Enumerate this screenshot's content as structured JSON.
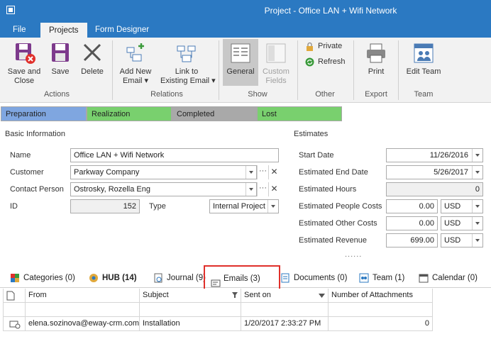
{
  "window": {
    "title": "Project - Office LAN + Wifi Network"
  },
  "menu_tabs": [
    "File",
    "Projects",
    "Form Designer"
  ],
  "ribbon": {
    "save_and_close": "Save and\nClose",
    "save": "Save",
    "delete": "Delete",
    "add_new_email": "Add New\nEmail ▾",
    "link_existing_email": "Link to\nExisting Email ▾",
    "general": "General",
    "custom_fields": "Custom\nFields",
    "private": "Private",
    "refresh": "Refresh",
    "print": "Print",
    "edit_team": "Edit Team",
    "groups": {
      "actions": "Actions",
      "relations": "Relations",
      "show": "Show",
      "other": "Other",
      "export": "Export",
      "team": "Team"
    }
  },
  "stages": [
    {
      "label": "Preparation",
      "color": "#7fa6e0"
    },
    {
      "label": "Realization",
      "color": "#79d06e"
    },
    {
      "label": "Completed",
      "color": "#a9a9a9"
    },
    {
      "label": "Lost",
      "color": "#79d06e"
    }
  ],
  "basic": {
    "heading": "Basic Information",
    "name_label": "Name",
    "name_value": "Office LAN + Wifi Network",
    "customer_label": "Customer",
    "customer_value": "Parkway Company",
    "contact_label": "Contact Person",
    "contact_value": "Ostrosky, Rozella Eng",
    "id_label": "ID",
    "id_value": "152",
    "type_label": "Type",
    "type_value": "Internal Project",
    "dots": "···",
    "clear": "✕"
  },
  "estimates": {
    "heading": "Estimates",
    "start_label": "Start Date",
    "start_value": "11/26/2016",
    "end_label": "Estimated End Date",
    "end_value": "5/26/2017",
    "hours_label": "Estimated Hours",
    "hours_value": "0",
    "people_label": "Estimated People Costs",
    "people_value": "0.00",
    "people_currency": "USD",
    "other_label": "Estimated Other Costs",
    "other_value": "0.00",
    "other_currency": "USD",
    "revenue_label": "Estimated Revenue",
    "revenue_value": "699.00",
    "revenue_currency": "USD",
    "more": "......"
  },
  "bottom_tabs": [
    "Categories (0)",
    "HUB (14)",
    "Journal (9)",
    "Emails (3)",
    "Documents (0)",
    "Team (1)",
    "Calendar (0)"
  ],
  "emails_grid": {
    "columns": [
      "From",
      "Subject",
      "Sent on",
      "Number of Attachments"
    ],
    "rows": [
      {
        "from": "elena.sozinova@eway-crm.com",
        "subject": "Installation",
        "sent_on": "1/20/2017 2:33:27 PM",
        "attachments": "0"
      }
    ]
  }
}
